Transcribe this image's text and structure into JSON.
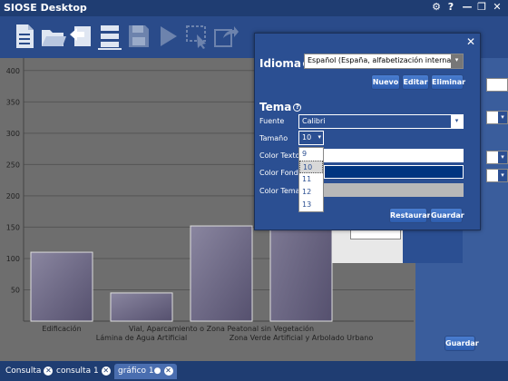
{
  "window": {
    "title": "SIOSE Desktop"
  },
  "toolbar": {
    "icons": [
      "document-icon",
      "folder-open-icon",
      "import-icon",
      "server-icon",
      "save-icon",
      "run-icon",
      "select-region-icon",
      "export-icon"
    ]
  },
  "chart_data": {
    "type": "bar",
    "categories": [
      "Edificación",
      "Lámina de Agua Artificial",
      "Vial, Aparcamiento o Zona Peatonal sin Vegetación",
      "Zona Verde Artificial y Arbolado Urbano"
    ],
    "values": [
      110,
      45,
      152,
      300
    ],
    "yticks": [
      50,
      100,
      150,
      200,
      250,
      300,
      350,
      400
    ],
    "ylim": [
      0,
      420
    ],
    "grid": true
  },
  "dialog": {
    "idioma_title": "Idioma",
    "idioma_value": "Español (España, alfabetización internacional)",
    "nuevo": "Nuevo",
    "editar": "Editar",
    "eliminar": "Eliminar",
    "tema_title": "Tema",
    "fuente_label": "Fuente",
    "fuente_value": "Calibri",
    "tamano_label": "Tamaño",
    "tamano_value": "10",
    "color_texto_label": "Color Texto",
    "color_fondo_label": "Color Fondo",
    "color_tema_label": "Color Tema",
    "size_options": [
      "9",
      "10",
      "11",
      "12",
      "13"
    ],
    "restaurar": "Restaurar",
    "guardar": "Guardar"
  },
  "right_panel": {
    "guardar": "Guardar"
  },
  "tabs": [
    {
      "label": "Consulta"
    },
    {
      "label": "consulta 1"
    },
    {
      "label": "gráfico 1●"
    }
  ],
  "colors": {
    "bar": "#5f5a78",
    "accent": "#2b4f92"
  }
}
